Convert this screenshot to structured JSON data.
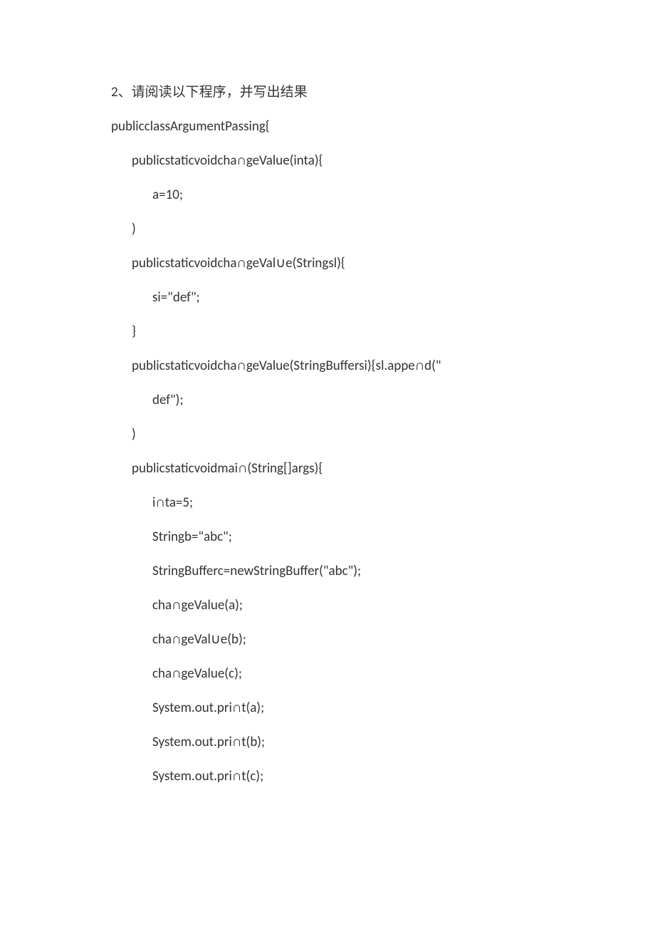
{
  "lines": {
    "l0": "2、请阅读以下程序，并写出结果",
    "l1": "publicclassArgumentPassing{",
    "l2": "publicstaticvoidcha∩geValue(inta){",
    "l3": "a=10;",
    "l4": ")",
    "l5": "publicstaticvoidcha∩geVal∪e(Stringsl){",
    "l6": "si=\"def\";",
    "l7": "}",
    "l8": "publicstaticvoidcha∩geValue(StringBuffersi){sl.appe∩d(\"",
    "l9": "def\");",
    "l10": ")",
    "l11": "publicstaticvoidmai∩(String[]args){",
    "l12": "i∩ta=5;",
    "l13": "Stringb=\"abc\";",
    "l14": "StringBufferc=newStringBuffer(\"abc\");",
    "l15": "cha∩geValue(a);",
    "l16": "cha∩geVal∪e(b);",
    "l17": "cha∩geValue(c);",
    "l18": "System.out.pri∩t(a);",
    "l19": "System.out.pri∩t(b);",
    "l20": "System.out.pri∩t(c);"
  }
}
